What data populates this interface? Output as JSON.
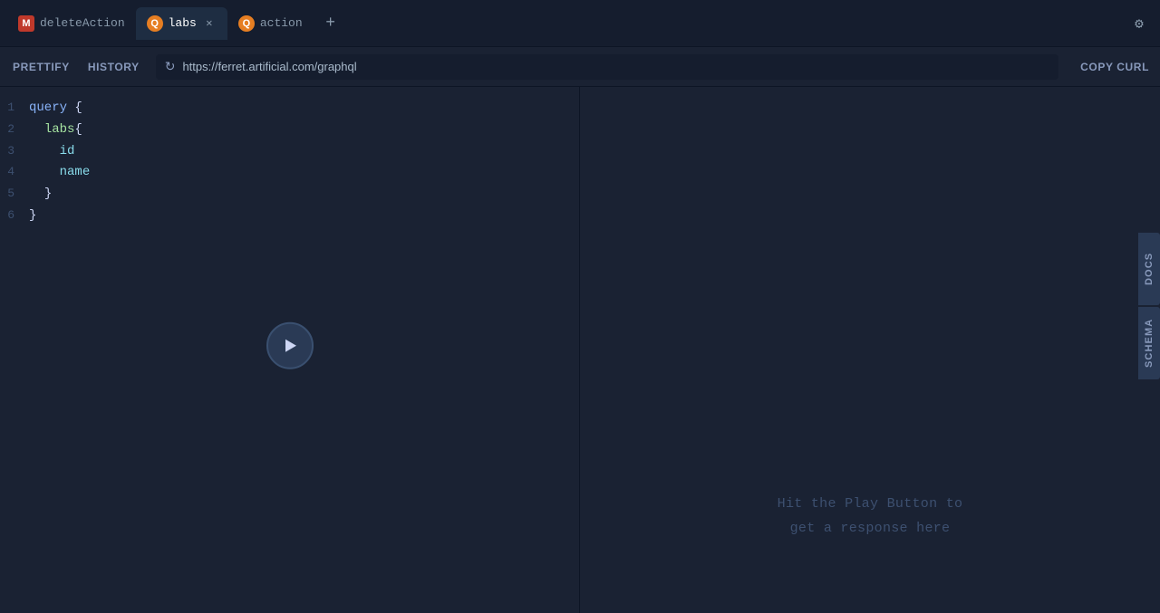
{
  "tabs": [
    {
      "id": "deleteAction",
      "label": "deleteAction",
      "icon_type": "M",
      "active": false,
      "closeable": false
    },
    {
      "id": "labs",
      "label": "labs",
      "icon_type": "Q",
      "active": true,
      "closeable": true
    },
    {
      "id": "action",
      "label": "action",
      "icon_type": "Q",
      "active": false,
      "closeable": false
    }
  ],
  "toolbar": {
    "prettify_label": "PRETTIFY",
    "history_label": "HISTORY",
    "url": "https://ferret.artificial.com/graphql",
    "copy_curl_label": "COPY CURL"
  },
  "editor": {
    "lines": [
      {
        "num": "1",
        "indent": 0,
        "tokens": [
          {
            "text": "query",
            "class": "kw-query"
          },
          {
            "text": " {",
            "class": "punct"
          }
        ]
      },
      {
        "num": "2",
        "indent": 1,
        "tokens": [
          {
            "text": "labs",
            "class": "kw-field"
          },
          {
            "text": "{",
            "class": "punct"
          }
        ]
      },
      {
        "num": "3",
        "indent": 2,
        "tokens": [
          {
            "text": "id",
            "class": "kw-field2"
          }
        ]
      },
      {
        "num": "4",
        "indent": 2,
        "tokens": [
          {
            "text": "name",
            "class": "kw-field2"
          }
        ]
      },
      {
        "num": "5",
        "indent": 1,
        "tokens": [
          {
            "text": "}",
            "class": "punct"
          }
        ]
      },
      {
        "num": "6",
        "indent": 0,
        "tokens": [
          {
            "text": "}",
            "class": "punct"
          }
        ]
      }
    ]
  },
  "result_placeholder": {
    "line1": "Hit the Play Button to",
    "line2": "get a response here"
  },
  "side_buttons": [
    {
      "id": "docs",
      "label": "DOCS"
    },
    {
      "id": "schema",
      "label": "SCHEMA"
    }
  ],
  "settings_icon": "⚙"
}
